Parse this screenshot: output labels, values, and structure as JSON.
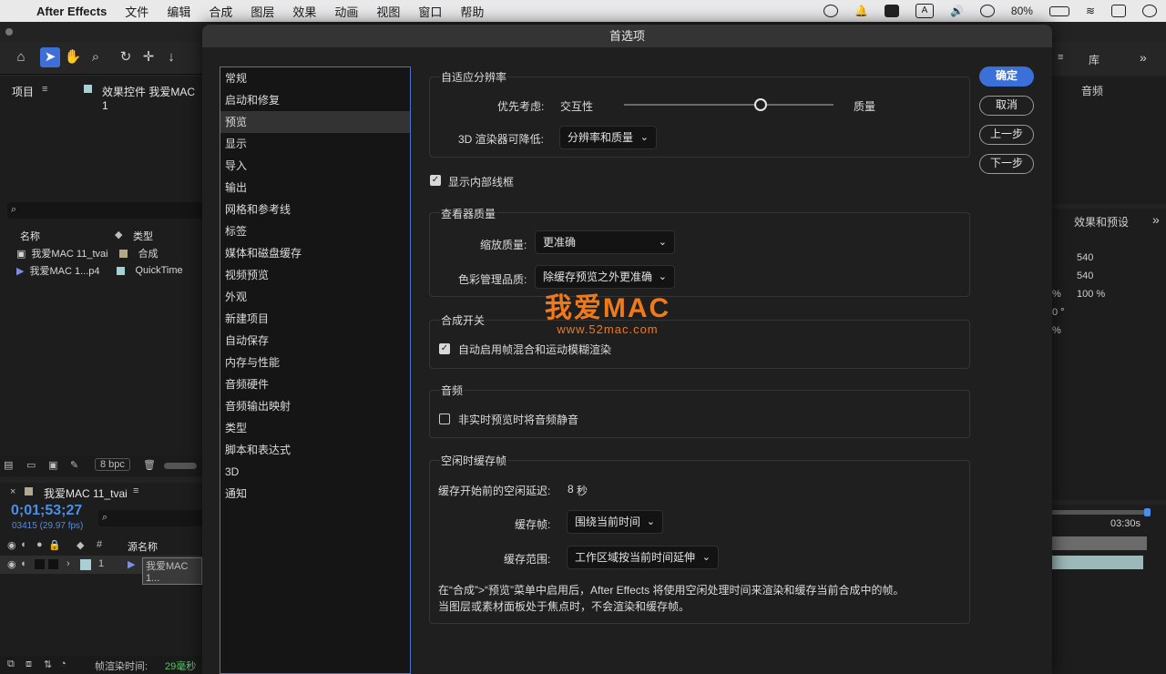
{
  "menubar": {
    "apple": "",
    "app_name": "After Effects",
    "items": [
      "文件",
      "编辑",
      "合成",
      "图层",
      "效果",
      "动画",
      "视图",
      "窗口",
      "帮助"
    ],
    "battery": "80%"
  },
  "project_panel": {
    "tab": "项目",
    "effects_tab": "效果控件 我爱MAC 1",
    "col_name": "名称",
    "col_type": "类型",
    "items": [
      {
        "name": "我爱MAC 11_tvai",
        "type": "合成",
        "color": "#b2a88a"
      },
      {
        "name": "我爱MAC 1...p4",
        "type": "QuickTime",
        "color": "#a8cfd4"
      }
    ],
    "bpc": "8 bpc"
  },
  "timeline": {
    "comp_name": "我爱MAC 11_tvai",
    "timecode": "0;01;53;27",
    "frame_info": "03415 (29.97 fps)",
    "col_source": "源名称",
    "col_num": "#",
    "layer_num": "1",
    "layer_name": "我爱MAC 1...",
    "render_label": "帧渲染时间:",
    "render_value": "29毫秒"
  },
  "right_panels": {
    "library_tab": "库",
    "audio_tab": "音频",
    "effects_presets_tab": "效果和预设",
    "values": [
      "540",
      "540",
      "%",
      "100 %",
      "0 °",
      "%"
    ],
    "time_marker": "03:30s"
  },
  "dialog": {
    "title": "首选项",
    "categories": [
      "常规",
      "启动和修复",
      "预览",
      "显示",
      "导入",
      "输出",
      "网格和参考线",
      "标签",
      "媒体和磁盘缓存",
      "视频预览",
      "外观",
      "新建项目",
      "自动保存",
      "内存与性能",
      "音频硬件",
      "音频输出映射",
      "类型",
      "脚本和表达式",
      "3D",
      "通知"
    ],
    "selected_category": "预览",
    "adaptive": {
      "title": "自适应分辨率",
      "priority_label": "优先考虑:",
      "left": "交互性",
      "right": "质量",
      "slider_value": 0.65,
      "renderer_label": "3D 渲染器可降低:",
      "renderer_value": "分辨率和质量"
    },
    "show_wireframe": {
      "label": "显示内部线框",
      "checked": true
    },
    "viewer": {
      "title": "查看器质量",
      "zoom_label": "缩放质量:",
      "zoom_value": "更准确",
      "color_label": "色彩管理品质:",
      "color_value": "除缓存预览之外更准确"
    },
    "comp_switches": {
      "title": "合成开关",
      "auto_label": "自动启用帧混合和运动模糊渲染",
      "checked": true
    },
    "audio": {
      "title": "音频",
      "mute_label": "非实时预览时将音频静音",
      "checked": false
    },
    "idle_cache": {
      "title": "空闲时缓存帧",
      "delay_label": "缓存开始前的空闲延迟:",
      "delay_value": "8",
      "delay_unit": "秒",
      "frames_label": "缓存帧:",
      "frames_value": "围绕当前时间",
      "range_label": "缓存范围:",
      "range_value": "工作区域按当前时间延伸",
      "note1": "在“合成”>“预览”菜单中启用后，After Effects 将使用空闲处理时间来渲染和缓存当前合成中的帧。",
      "note2": "当图层或素材面板处于焦点时，不会渲染和缓存帧。"
    },
    "buttons": {
      "ok": "确定",
      "cancel": "取消",
      "prev": "上一步",
      "next": "下一步"
    }
  },
  "watermark": {
    "main": "我爱MAC",
    "sub": "www.52mac.com"
  }
}
